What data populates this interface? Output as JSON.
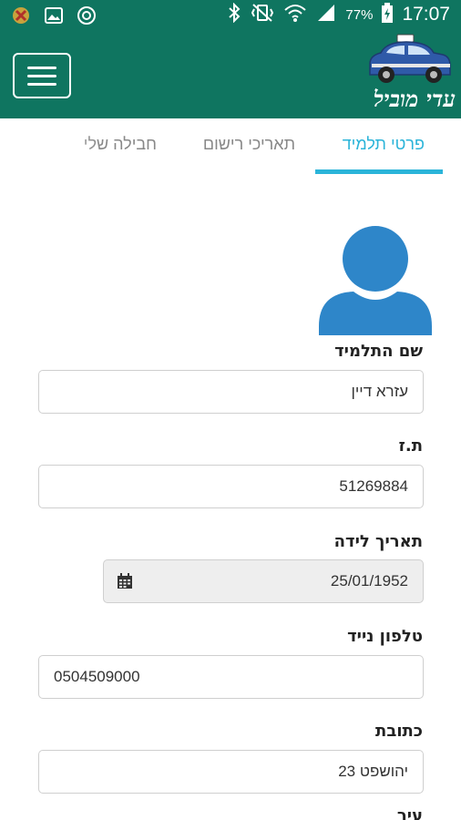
{
  "status_bar": {
    "left_icons": [
      "app-notification-icon",
      "gallery-icon",
      "data-saver-icon"
    ],
    "right_icons": [
      "bluetooth-icon",
      "vibrate-icon",
      "wifi-icon",
      "signal-icon",
      "battery-icon"
    ],
    "battery_percent": "77%",
    "time": "17:07"
  },
  "header": {
    "app_name": "עדי מוביל",
    "menu_icon": "hamburger-icon",
    "logo_icon": "car-icon",
    "color": "#0f7560"
  },
  "tabs": [
    {
      "label": "פרטי תלמיד",
      "active": true
    },
    {
      "label": "תאריכי רישום",
      "active": false
    },
    {
      "label": "חבילה שלי",
      "active": false
    }
  ],
  "accent_color": "#2bb4d9",
  "form": {
    "student_name": {
      "label": "שם התלמיד",
      "value": "עזרא דיין"
    },
    "id_number": {
      "label": "ת.ז",
      "value": "51269884"
    },
    "birth_date": {
      "label": "תאריך לידה",
      "value": "25/01/1952",
      "icon": "calendar-icon"
    },
    "mobile_phone": {
      "label": "טלפון נייד",
      "value": "0504509000"
    },
    "address": {
      "label": "כתובת",
      "value": "יהושפט 23"
    },
    "next_label": "עיר"
  }
}
